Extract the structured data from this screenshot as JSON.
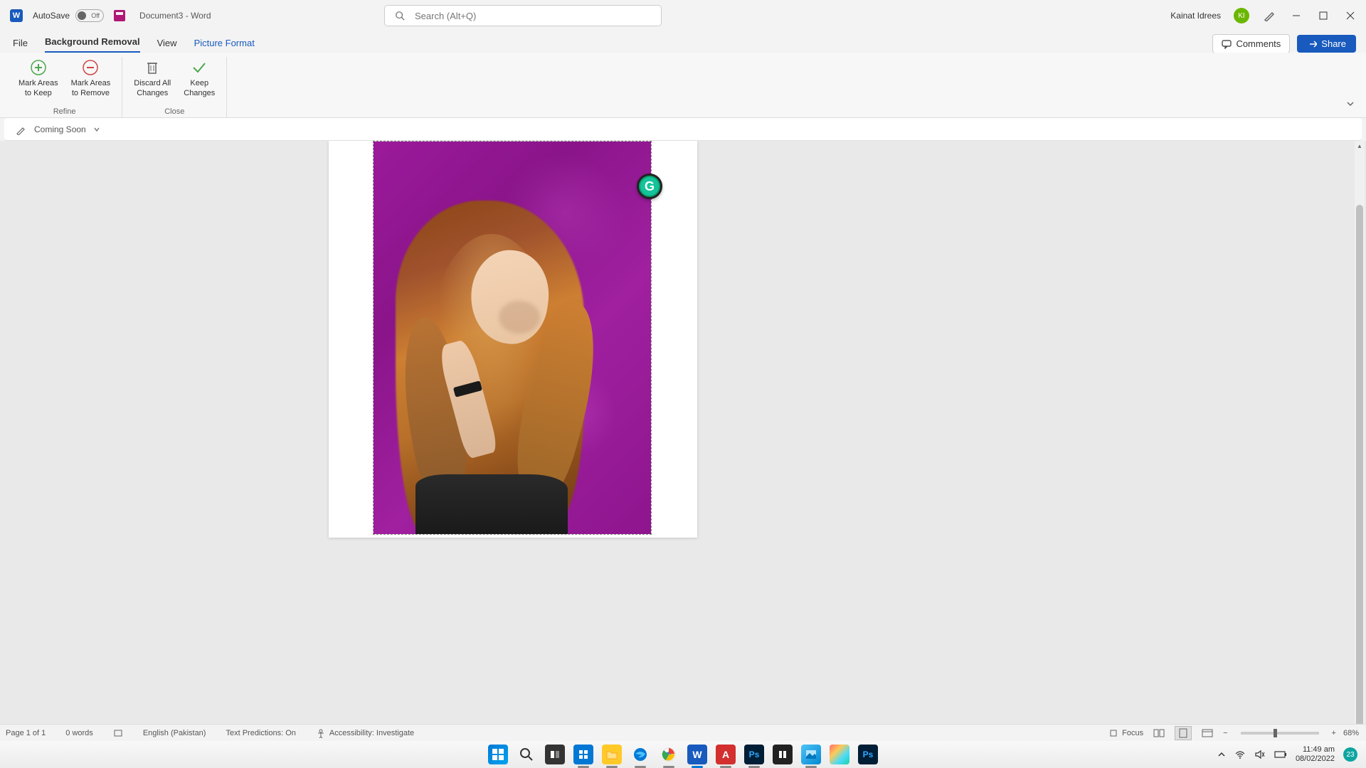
{
  "title_bar": {
    "autosave_label": "AutoSave",
    "autosave_state": "Off",
    "document_title": "Document3  -  Word",
    "search_placeholder": "Search (Alt+Q)",
    "user_name": "Kainat Idrees",
    "user_initials": "KI"
  },
  "tabs": {
    "file": "File",
    "background_removal": "Background Removal",
    "view": "View",
    "picture_format": "Picture Format",
    "comments": "Comments",
    "share": "Share"
  },
  "ribbon": {
    "mark_keep": "Mark Areas\nto Keep",
    "mark_remove": "Mark Areas\nto Remove",
    "discard": "Discard All\nChanges",
    "keep": "Keep\nChanges",
    "group_refine": "Refine",
    "group_close": "Close"
  },
  "quick_bar": {
    "coming_soon": "Coming Soon"
  },
  "grammarly": {
    "letter": "G"
  },
  "status": {
    "page": "Page 1 of 1",
    "words": "0 words",
    "language": "English (Pakistan)",
    "predictions": "Text Predictions: On",
    "accessibility": "Accessibility: Investigate",
    "focus": "Focus",
    "zoom": "68%"
  },
  "tray": {
    "time": "11:49 am",
    "date": "08/02/2022",
    "badge": "23"
  },
  "colors": {
    "word_blue": "#185abd",
    "purple_bg": "#9b1a9b",
    "grammarly": "#15c39a"
  }
}
